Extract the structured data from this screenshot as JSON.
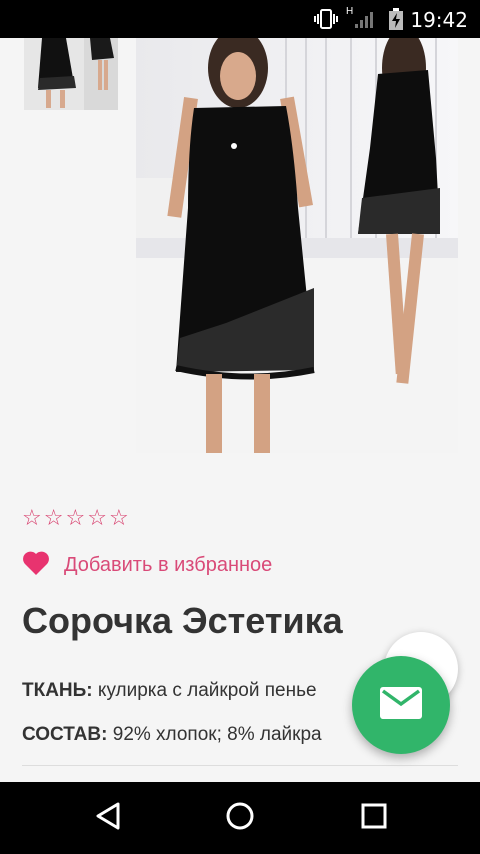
{
  "status_bar": {
    "time": "19:42",
    "network_label": "H",
    "icons": [
      "vibrate-icon",
      "signal-icon",
      "battery-charging-icon"
    ]
  },
  "product": {
    "rating": {
      "value": 0,
      "max": 5,
      "star_color": "#d73c6b"
    },
    "favorite_label": "Добавить в избранное",
    "favorite_color": "#e8336f",
    "title": "Сорочка Эстетика",
    "properties": [
      {
        "key": "ТКАНЬ:",
        "value": "кулирка с лайкрой пенье"
      },
      {
        "key": "СОСТАВ:",
        "value": "92% хлопок; 8% лайкра"
      }
    ]
  },
  "fab": {
    "icon": "mail-icon",
    "color": "#31b56a"
  },
  "nav_bar": {
    "icons": [
      "back-icon",
      "home-icon",
      "recents-icon"
    ]
  }
}
